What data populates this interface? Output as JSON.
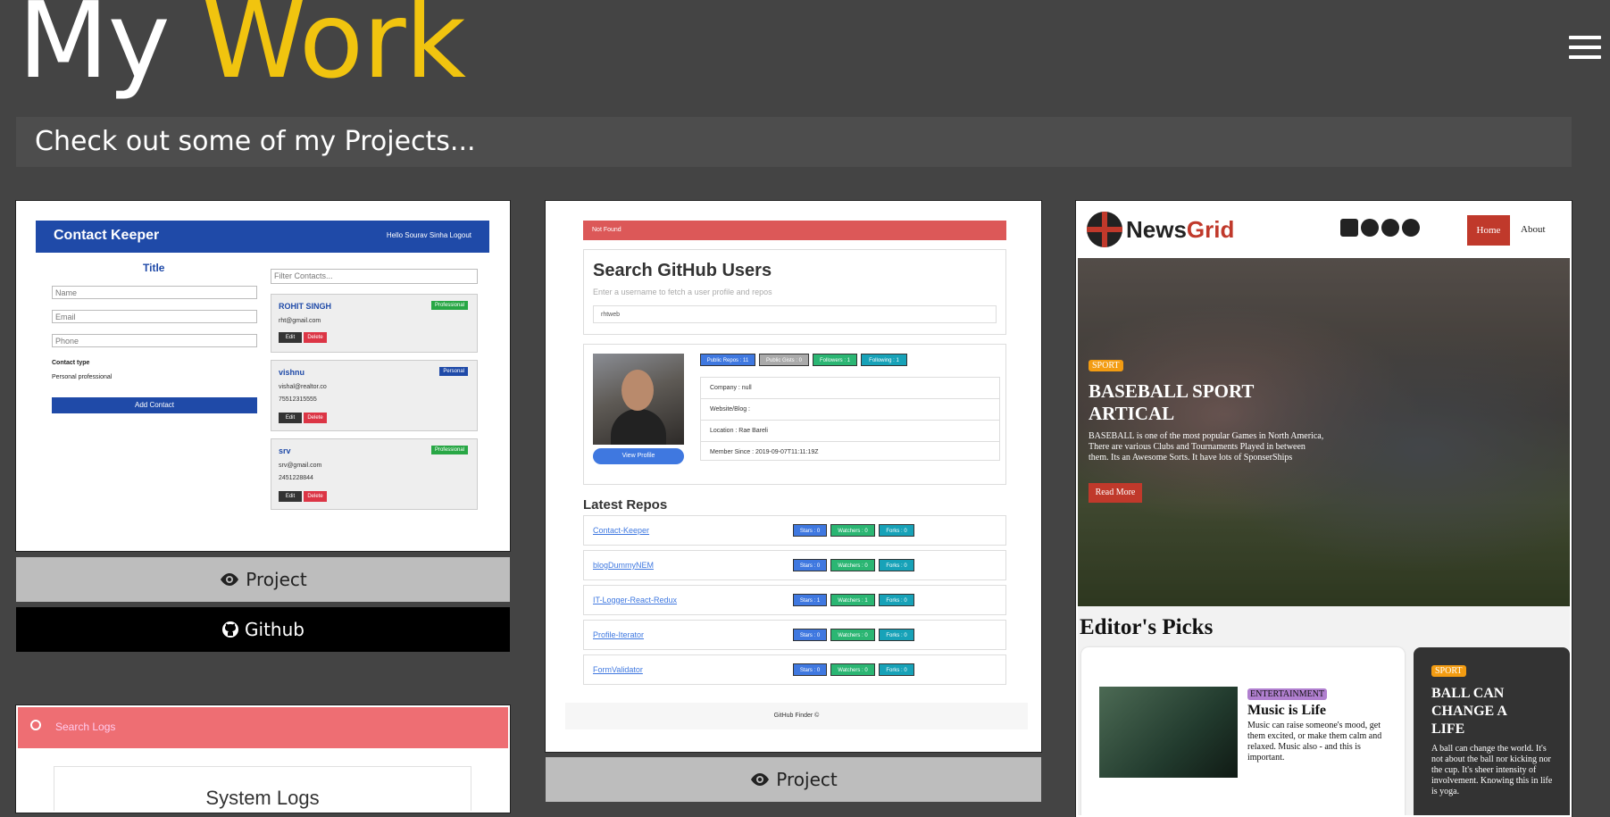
{
  "header": {
    "title_part1": "My",
    "title_part2": "Work",
    "accent_color": "#f1c40f",
    "menu_icon": "hamburger-icon"
  },
  "subtitle": "Check out some of my Projects...",
  "projects": [
    {
      "name": "contact-keeper",
      "screenshot": {
        "brand": "Contact Keeper",
        "greeting": "Hello Sourav Sinha  Logout",
        "form_title": "Title",
        "inputs": [
          "Name",
          "Email",
          "Phone"
        ],
        "contact_type_label": "Contact type",
        "radio_text": "Personal  professional",
        "add_button": "Add Contact",
        "filter_placeholder": "Filter Contacts...",
        "contacts": [
          {
            "name": "ROHIT SINGH",
            "badge": "Professional",
            "email": "rht@gmail.com",
            "phone": ""
          },
          {
            "name": "vishnu",
            "badge": "Personal",
            "email": "vishal@realtor.co",
            "phone": "75512315555"
          },
          {
            "name": "srv",
            "badge": "Professional",
            "email": "srv@gmail.com",
            "phone": "2451228844"
          }
        ],
        "edit_label": "Edit",
        "delete_label": "Delete"
      },
      "project_label": "Project",
      "github_label": "Github"
    },
    {
      "name": "github-finder",
      "screenshot": {
        "alert": "Not Found",
        "heading": "Search GitHub Users",
        "subheading": "Enter a username to fetch a user profile and repos",
        "search_value": "rhtweb",
        "stats": [
          "Public Repos : 11",
          "Public Gists : 0",
          "Followers : 1",
          "Following : 1"
        ],
        "info": [
          "Company : null",
          "Website/Blog :",
          "Location : Rae Bareli",
          "Member Since : 2019-09-07T11:11:19Z"
        ],
        "view_profile": "View Profile",
        "latest_repos": "Latest Repos",
        "repos": [
          {
            "name": "Contact-Keeper",
            "stars": "Stars : 0",
            "watchers": "Watchers : 0",
            "forks": "Forks : 0"
          },
          {
            "name": "blogDummyNEM",
            "stars": "Stars : 0",
            "watchers": "Watchers : 0",
            "forks": "Forks : 0"
          },
          {
            "name": "IT-Logger-React-Redux",
            "stars": "Stars : 1",
            "watchers": "Watchers : 1",
            "forks": "Forks : 0"
          },
          {
            "name": "Profile-Iterator",
            "stars": "Stars : 0",
            "watchers": "Watchers : 0",
            "forks": "Forks : 0"
          },
          {
            "name": "FormValidator",
            "stars": "Stars : 0",
            "watchers": "Watchers : 0",
            "forks": "Forks : 0"
          }
        ],
        "footer": "GitHub Finder ©"
      },
      "project_label": "Project"
    },
    {
      "name": "newsgrid",
      "screenshot": {
        "brand_a": "News",
        "brand_b": "Grid",
        "nav_home": "Home",
        "nav_about": "About",
        "hero_tag": "SPORT",
        "hero_title": "BASEBALL SPORT ARTICAL",
        "hero_text": "BASEBALL is one of the most popular Games in North America, There are various Clubs and Tournaments Played in between them. Its an Awesome Sorts. It have lots of SponserShips",
        "read_more": "Read More",
        "editors_picks": "Editor's Picks",
        "card1_tag": "ENTERTAINMENT",
        "card1_title": "Music is Life",
        "card1_text": "Music can raise someone's mood, get them excited, or make them calm and relaxed. Music also - and this is important.",
        "card2_tag": "SPORT",
        "card2_title": "BALL CAN CHANGE A LIFE",
        "card2_text": "A ball can change the world. It's not about the ball nor kicking nor the cup. It's sheer intensity of involvement. Knowing this in life is yoga."
      }
    },
    {
      "name": "system-logs",
      "screenshot": {
        "search_placeholder": "Search Logs",
        "panel_title": "System Logs"
      }
    }
  ]
}
